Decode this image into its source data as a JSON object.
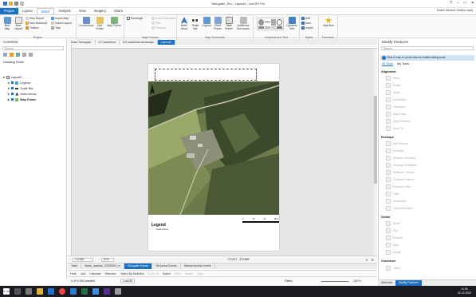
{
  "window": {
    "title": "Tartugaler_Pro - Layout2 - ArcGIS Pro",
    "user": "Katrin Mustve (Harku vald)"
  },
  "menu": [
    "Project",
    "Layout",
    "Insert",
    "Analysis",
    "View",
    "Imagery",
    "Share"
  ],
  "active_menu": "Insert",
  "ribbon": {
    "project": {
      "label": "Project",
      "new_map": "New Map",
      "new_layout": "New Layout",
      "new_report": "New Report",
      "new_notebook": "New Notebook",
      "toolbox": "Toolbox",
      "import_map": "Import Map",
      "import_layout": "Import Layout",
      "task": "Task"
    },
    "layers": {
      "connections": "Connections",
      "add_folder": "Add Folder",
      "map_frame": "Map Frame"
    },
    "map_frames": {
      "label": "Map Frames",
      "rectangle": "Rectangle",
      "extent_indicators": "Extent Indicators",
      "grid": "Grid",
      "reshape": "Reshape"
    },
    "map_surrounds": {
      "label": "Map Surrounds",
      "north_arrow": "North Arrow",
      "scale_bar": "Scale Bar",
      "legend": "Legend",
      "chart_frame": "Chart Frame",
      "table_frame": "Table Frame",
      "additional": "Additional Surrounds"
    },
    "graphics": {
      "label": "Graphics and Text",
      "dynamic_text": "Dynamic Text"
    },
    "styles": {
      "label": "Styles",
      "add": "Add",
      "new": "New",
      "import": "Import"
    },
    "favorites": {
      "label": "Favorites",
      "add_item": "Add Item"
    }
  },
  "contents": {
    "title": "Contents",
    "search_placeholder": "Search",
    "drawing_order": "Drawing Order",
    "tree": [
      "Layout2",
      "Legend",
      "Scale Bar",
      "North Arrow",
      "Map Frame"
    ]
  },
  "view_tabs": [
    "Kaart Tartugaler",
    "KO saadvima",
    "KO saadvima landscape",
    "Layout2"
  ],
  "active_view_tab": "Layout2",
  "layout": {
    "legend_title": "Legend",
    "legend_subtitle": "katastriüksus",
    "scale_labels": [
      "0",
      "20",
      "40",
      "80 m"
    ]
  },
  "map_status": {
    "scale": "1:2,000",
    "zoom": "67%",
    "coords": "772,517 , 372,889"
  },
  "bottom_tabs": [
    "Tasid",
    "Harku_maaüse_20180529_m",
    "Tartugaler Events",
    "Tee jactus Events",
    "Tatuma huvitus Events"
  ],
  "active_bottom_tab": "Tartugaler Events",
  "table_toolbar": {
    "field": "Field:",
    "add": "Add",
    "calculate": "Calculate",
    "selection": "Selection:",
    "select_by_attributes": "Select By Attributes",
    "zoom_to": "Zoom To",
    "switch": "Switch",
    "clear": "Clear",
    "delete": "Delete",
    "copy": "Copy",
    "status": "0 of *2 000 selected",
    "load_all": "Load All",
    "filters": "Filters:",
    "zoom_pct": "100 %"
  },
  "modify": {
    "title": "Modify Features",
    "search_placeholder": "Search",
    "info": "Click a map or scene view to enable editing tools.",
    "tabs": [
      "All Tools",
      "My Tools"
    ],
    "sections": [
      {
        "name": "Alignment",
        "tools": [
          "Move",
          "Rotate",
          "Scale",
          "Annotation",
          "Transform",
          "Align Edge",
          "Align Features",
          "Move To"
        ]
      },
      {
        "name": "Reshape",
        "tools": [
          "Edit Vertices",
          "Reshape",
          "Replace Geometry",
          "Reshape Multipatch",
          "Multipatch Texture",
          "Continue Feature",
          "Extend or Trim",
          "Fillet",
          "Generalize",
          "Line Intersection"
        ]
      },
      {
        "name": "Divide",
        "tools": [
          "Buffer",
          "Clip",
          "Explode",
          "Split",
          "Merge"
        ]
      },
      {
        "name": "Construct",
        "tools": [
          "Offset"
        ]
      }
    ],
    "bottom_tabs": [
      "Attributes",
      "Modify Features"
    ],
    "active_bottom_tab": "Modify Features"
  },
  "taskbar": {
    "time": "11:06",
    "date": "22.12.2020"
  }
}
